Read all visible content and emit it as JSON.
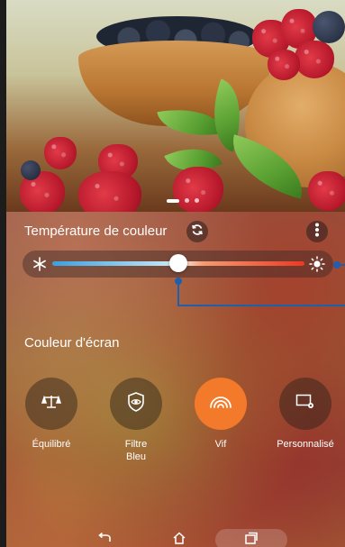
{
  "photo": {
    "pager": {
      "count": 3,
      "active_index": 0
    }
  },
  "color_temperature": {
    "title": "Température de couleur",
    "reset_icon": "refresh-icon",
    "menu_icon": "more-vertical-icon",
    "cold_icon": "snowflake-icon",
    "warm_icon": "sun-icon",
    "slider_value": 0.5,
    "gradient_colors": [
      "#3aa0e0",
      "#f4f0ea",
      "#ea3a22"
    ]
  },
  "screen_color": {
    "title": "Couleur d'écran",
    "modes": [
      {
        "label": "Équilibré",
        "icon": "balance-scale-icon",
        "selected": false
      },
      {
        "label": "Filtre\nBleu",
        "icon": "eye-shield-icon",
        "selected": false
      },
      {
        "label": "Vif",
        "icon": "vivid-rainbow-icon",
        "selected": true
      },
      {
        "label": "Personnalisé",
        "icon": "custom-settings-icon",
        "selected": false
      }
    ]
  },
  "accent_color": "#f27a2a",
  "annotation_color": "#1f5fae",
  "navbar": {
    "back_icon": "back-arrow-icon",
    "home_icon": "home-icon",
    "recent_icon": "recent-apps-icon"
  }
}
